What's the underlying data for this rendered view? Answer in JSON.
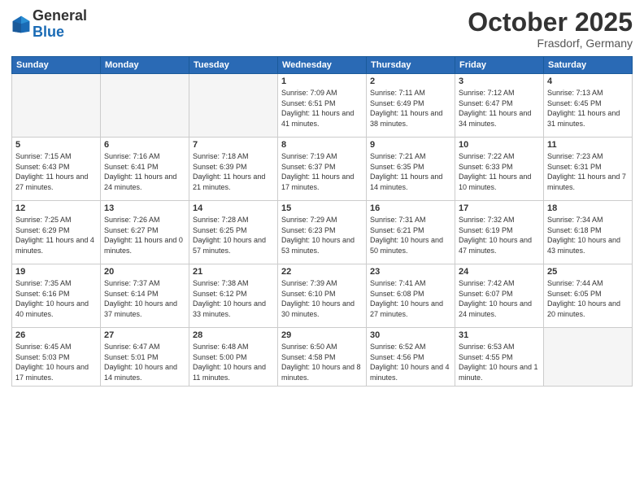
{
  "logo": {
    "general": "General",
    "blue": "Blue"
  },
  "title": "October 2025",
  "subtitle": "Frasdorf, Germany",
  "days_of_week": [
    "Sunday",
    "Monday",
    "Tuesday",
    "Wednesday",
    "Thursday",
    "Friday",
    "Saturday"
  ],
  "weeks": [
    [
      {
        "day": "",
        "empty": true
      },
      {
        "day": "",
        "empty": true
      },
      {
        "day": "",
        "empty": true
      },
      {
        "day": "1",
        "sunrise": "7:09 AM",
        "sunset": "6:51 PM",
        "daylight": "11 hours and 41 minutes."
      },
      {
        "day": "2",
        "sunrise": "7:11 AM",
        "sunset": "6:49 PM",
        "daylight": "11 hours and 38 minutes."
      },
      {
        "day": "3",
        "sunrise": "7:12 AM",
        "sunset": "6:47 PM",
        "daylight": "11 hours and 34 minutes."
      },
      {
        "day": "4",
        "sunrise": "7:13 AM",
        "sunset": "6:45 PM",
        "daylight": "11 hours and 31 minutes."
      }
    ],
    [
      {
        "day": "5",
        "sunrise": "7:15 AM",
        "sunset": "6:43 PM",
        "daylight": "11 hours and 27 minutes."
      },
      {
        "day": "6",
        "sunrise": "7:16 AM",
        "sunset": "6:41 PM",
        "daylight": "11 hours and 24 minutes."
      },
      {
        "day": "7",
        "sunrise": "7:18 AM",
        "sunset": "6:39 PM",
        "daylight": "11 hours and 21 minutes."
      },
      {
        "day": "8",
        "sunrise": "7:19 AM",
        "sunset": "6:37 PM",
        "daylight": "11 hours and 17 minutes."
      },
      {
        "day": "9",
        "sunrise": "7:21 AM",
        "sunset": "6:35 PM",
        "daylight": "11 hours and 14 minutes."
      },
      {
        "day": "10",
        "sunrise": "7:22 AM",
        "sunset": "6:33 PM",
        "daylight": "11 hours and 10 minutes."
      },
      {
        "day": "11",
        "sunrise": "7:23 AM",
        "sunset": "6:31 PM",
        "daylight": "11 hours and 7 minutes."
      }
    ],
    [
      {
        "day": "12",
        "sunrise": "7:25 AM",
        "sunset": "6:29 PM",
        "daylight": "11 hours and 4 minutes."
      },
      {
        "day": "13",
        "sunrise": "7:26 AM",
        "sunset": "6:27 PM",
        "daylight": "11 hours and 0 minutes."
      },
      {
        "day": "14",
        "sunrise": "7:28 AM",
        "sunset": "6:25 PM",
        "daylight": "10 hours and 57 minutes."
      },
      {
        "day": "15",
        "sunrise": "7:29 AM",
        "sunset": "6:23 PM",
        "daylight": "10 hours and 53 minutes."
      },
      {
        "day": "16",
        "sunrise": "7:31 AM",
        "sunset": "6:21 PM",
        "daylight": "10 hours and 50 minutes."
      },
      {
        "day": "17",
        "sunrise": "7:32 AM",
        "sunset": "6:19 PM",
        "daylight": "10 hours and 47 minutes."
      },
      {
        "day": "18",
        "sunrise": "7:34 AM",
        "sunset": "6:18 PM",
        "daylight": "10 hours and 43 minutes."
      }
    ],
    [
      {
        "day": "19",
        "sunrise": "7:35 AM",
        "sunset": "6:16 PM",
        "daylight": "10 hours and 40 minutes."
      },
      {
        "day": "20",
        "sunrise": "7:37 AM",
        "sunset": "6:14 PM",
        "daylight": "10 hours and 37 minutes."
      },
      {
        "day": "21",
        "sunrise": "7:38 AM",
        "sunset": "6:12 PM",
        "daylight": "10 hours and 33 minutes."
      },
      {
        "day": "22",
        "sunrise": "7:39 AM",
        "sunset": "6:10 PM",
        "daylight": "10 hours and 30 minutes."
      },
      {
        "day": "23",
        "sunrise": "7:41 AM",
        "sunset": "6:08 PM",
        "daylight": "10 hours and 27 minutes."
      },
      {
        "day": "24",
        "sunrise": "7:42 AM",
        "sunset": "6:07 PM",
        "daylight": "10 hours and 24 minutes."
      },
      {
        "day": "25",
        "sunrise": "7:44 AM",
        "sunset": "6:05 PM",
        "daylight": "10 hours and 20 minutes."
      }
    ],
    [
      {
        "day": "26",
        "sunrise": "6:45 AM",
        "sunset": "5:03 PM",
        "daylight": "10 hours and 17 minutes."
      },
      {
        "day": "27",
        "sunrise": "6:47 AM",
        "sunset": "5:01 PM",
        "daylight": "10 hours and 14 minutes."
      },
      {
        "day": "28",
        "sunrise": "6:48 AM",
        "sunset": "5:00 PM",
        "daylight": "10 hours and 11 minutes."
      },
      {
        "day": "29",
        "sunrise": "6:50 AM",
        "sunset": "4:58 PM",
        "daylight": "10 hours and 8 minutes."
      },
      {
        "day": "30",
        "sunrise": "6:52 AM",
        "sunset": "4:56 PM",
        "daylight": "10 hours and 4 minutes."
      },
      {
        "day": "31",
        "sunrise": "6:53 AM",
        "sunset": "4:55 PM",
        "daylight": "10 hours and 1 minute."
      },
      {
        "day": "",
        "empty": true
      }
    ]
  ]
}
